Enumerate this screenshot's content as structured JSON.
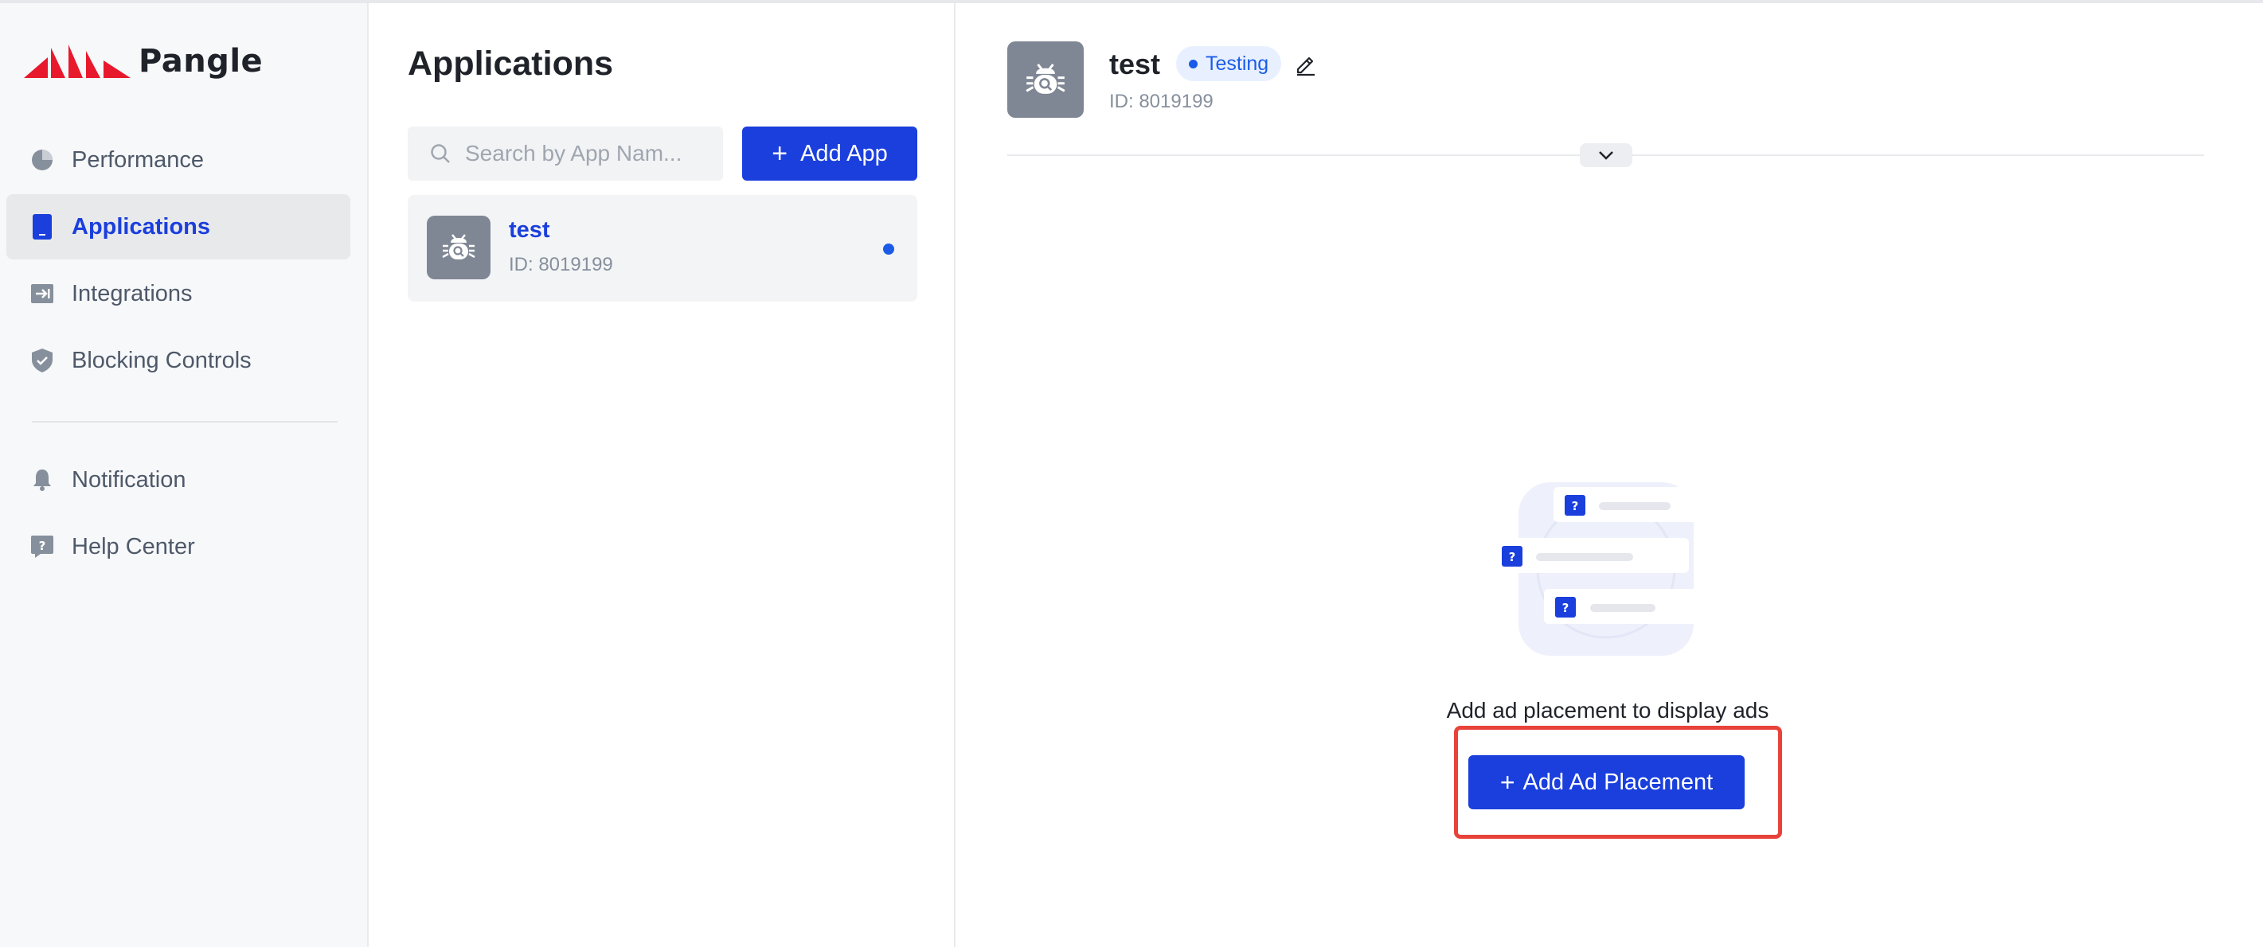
{
  "brand": {
    "name": "Pangle",
    "logo_color": "#e8192c"
  },
  "sidebar": {
    "items": [
      {
        "label": "Performance",
        "icon": "pie-chart-icon",
        "active": false
      },
      {
        "label": "Applications",
        "icon": "phone-icon",
        "active": true
      },
      {
        "label": "Integrations",
        "icon": "import-icon",
        "active": false
      },
      {
        "label": "Blocking Controls",
        "icon": "shield-icon",
        "active": false
      },
      {
        "label": "Notification",
        "icon": "bell-icon",
        "active": false
      },
      {
        "label": "Help Center",
        "icon": "help-icon",
        "active": false
      }
    ]
  },
  "apps": {
    "title": "Applications",
    "search": {
      "placeholder": "Search by App Nam...",
      "value": ""
    },
    "add_button": "Add App",
    "list": [
      {
        "name": "test",
        "id": "ID: 8019199",
        "icon": "bug-icon"
      }
    ]
  },
  "detail": {
    "name": "test",
    "status": "Testing",
    "id": "ID: 8019199",
    "empty_message": "Add ad placement to display ads",
    "add_button": "Add Ad Placement"
  },
  "colors": {
    "primary": "#1a3fdc",
    "highlight": "#e8433a",
    "status": "#1a5ce8"
  }
}
